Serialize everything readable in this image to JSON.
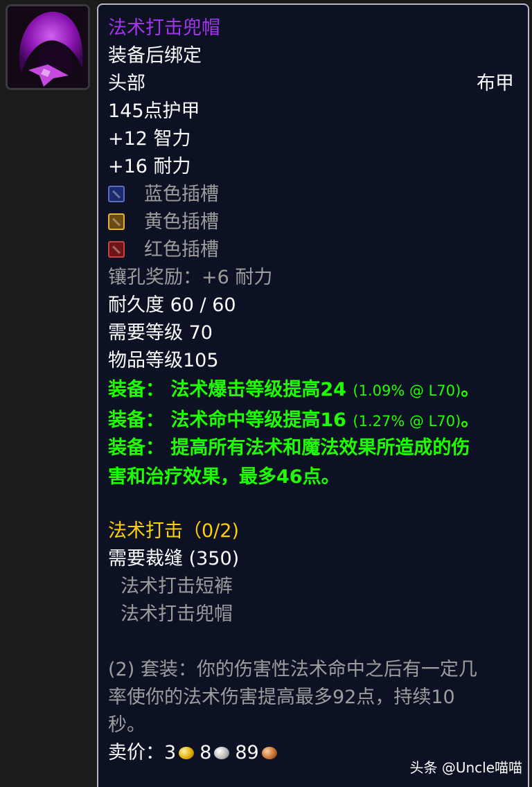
{
  "item": {
    "name": "法术打击兜帽",
    "binding": "装备后绑定",
    "slot": "头部",
    "armor_type": "布甲",
    "armor": "145点护甲",
    "stats": [
      "+12 智力",
      "+16 耐力"
    ],
    "sockets": [
      {
        "label": "蓝色插槽",
        "color": "#1b2a6e"
      },
      {
        "label": "黄色插槽",
        "color": "#6b4a12"
      },
      {
        "label": "红色插槽",
        "color": "#6e1616"
      }
    ],
    "socket_bonus": "镶孔奖励：+6 耐力",
    "durability": "耐久度 60 / 60",
    "required_level": "需要等级 70",
    "item_level": "物品等级105",
    "equip_effects": [
      {
        "text": "装备：  法术爆击等级提高24",
        "pct": "(1.09% @ L70)",
        "tail": "。"
      },
      {
        "text": "装备：  法术命中等级提高16",
        "pct": "(1.27% @ L70)",
        "tail": "。"
      }
    ],
    "equip_effect_3_line1": "装备：  提高所有法术和魔法效果所造成的伤",
    "equip_effect_3_line2": "害和治疗效果，最多46点。",
    "set": {
      "name": "法术打击（0/2)",
      "requirement": "需要裁缝 (350)",
      "pieces": [
        "法术打击短裤",
        "法术打击兜帽"
      ],
      "bonus_lines": [
        "(2) 套装：你的伤害性法术命中之后有一定几",
        "率使你的法术伤害提高最多92点，持续10",
        "秒。"
      ]
    },
    "sell_price": {
      "label": "卖价：",
      "gold": "3",
      "silver": "8",
      "copper": "89"
    }
  },
  "icon": {
    "name": "hood-icon",
    "color": "#a020c0"
  },
  "colors": {
    "epic_name": "#a335ee",
    "green_effect": "#1eff00",
    "set_gold": "#ffd100",
    "grey": "#9d9d9d",
    "background": "#0d1124"
  },
  "watermark": "头条 @Uncle喵喵"
}
